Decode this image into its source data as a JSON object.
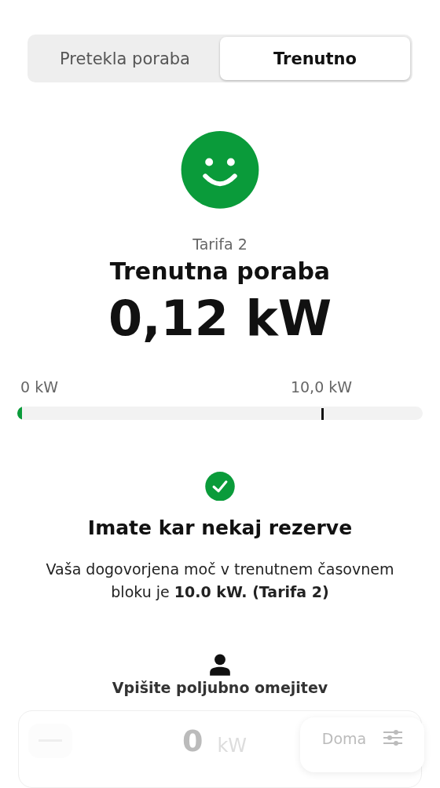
{
  "tabs": [
    {
      "label": "Pretekla poraba",
      "selected": false
    },
    {
      "label": "Trenutno",
      "selected": true
    }
  ],
  "status": {
    "happy": true,
    "tariff": "Tarifa 2",
    "title": "Trenutna poraba",
    "value": "0,12 kW"
  },
  "meter": {
    "min_label": "0 kW",
    "max_label": "10,0 kW",
    "level": 0.012,
    "limit": {
      "level": 0.75
    }
  },
  "notice": {
    "checked": true,
    "title": "Imate kar nekaj rezerve",
    "text": "Vaša dogovorjena moč v trenutnem časovnem bloku je **10.0 kW. (Tarifa 2)**"
  },
  "custom_limit": {
    "title": "Vpišite poljubno omejitev",
    "value": "0",
    "unit": "kW"
  },
  "location_button": {
    "label": "Doma"
  }
}
